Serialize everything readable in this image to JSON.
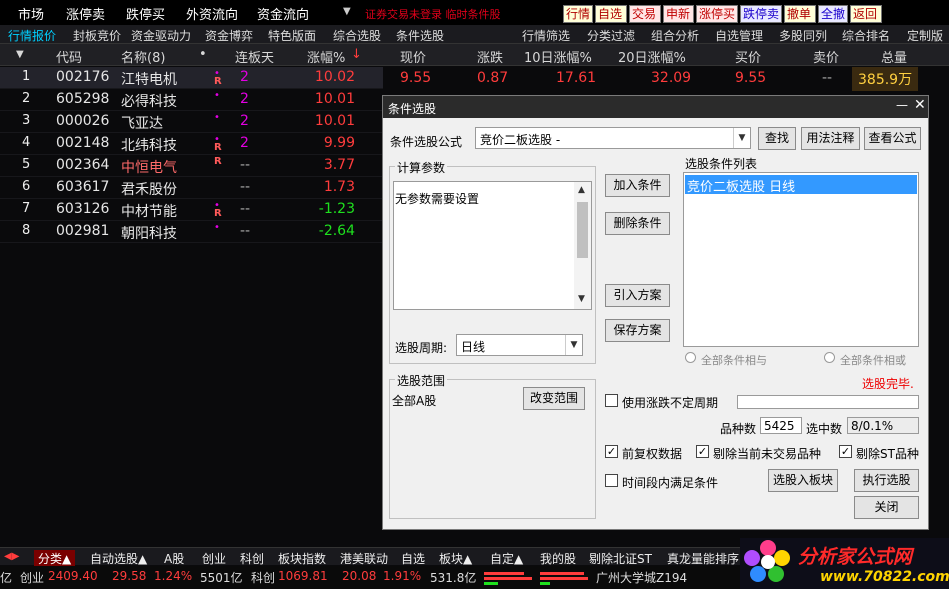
{
  "menu": [
    "市场",
    "涨停卖",
    "跌停买",
    "外资流向",
    "资金流向"
  ],
  "top_alert": "证券交易未登录  临时条件股",
  "quick": [
    {
      "label": "行情",
      "color": "#ffff00"
    },
    {
      "label": "自选",
      "color": "#ffff00"
    },
    {
      "label": "交易",
      "color": "#ff5a5a"
    },
    {
      "label": "申新",
      "color": "#ff5a5a"
    },
    {
      "label": "涨停买",
      "color": "#ff5a5a"
    },
    {
      "label": "跌停卖",
      "color": "#5a8cff"
    },
    {
      "label": "撤单",
      "color": "#ffff00"
    },
    {
      "label": "全撤",
      "color": "#5a8cff"
    },
    {
      "label": "返回",
      "color": "#ffff00"
    }
  ],
  "tabs": [
    "行情报价",
    "封板竞价",
    "资金驱动力",
    "资金博弈",
    "特色版面",
    "综合选股",
    "条件选股",
    "行情筛选",
    "分类过滤",
    "组合分析",
    "自选管理",
    "多股同列",
    "综合排名",
    "定制版"
  ],
  "header": {
    "sort": "▼",
    "code": "代码",
    "name": "名称(8)",
    "dot": "•",
    "days": "连板天",
    "pct": "涨幅%",
    "arrow": "↓",
    "price": "现价",
    "chg": "涨跌",
    "d10": "10日涨幅%",
    "d20": "20日涨幅%",
    "bid": "买价",
    "ask": "卖价",
    "total": "总量"
  },
  "rows": [
    {
      "n": "1",
      "code": "002176",
      "name": "江特电机",
      "dot": "•",
      "r": "R",
      "days": "2",
      "pct": "10.02",
      "pct_color": "red",
      "name_color": "#e6e6e6"
    },
    {
      "n": "2",
      "code": "605298",
      "name": "必得科技",
      "dot": "•",
      "r": "",
      "days": "2",
      "pct": "10.01",
      "pct_color": "red",
      "name_color": "#e6e6e6"
    },
    {
      "n": "3",
      "code": "000026",
      "name": "飞亚达",
      "dot": "•",
      "r": "",
      "days": "2",
      "pct": "10.01",
      "pct_color": "red",
      "name_color": "#e6e6e6"
    },
    {
      "n": "4",
      "code": "002148",
      "name": "北纬科技",
      "dot": "•",
      "r": "R",
      "days": "2",
      "pct": "9.99",
      "pct_color": "red",
      "name_color": "#e6e6e6"
    },
    {
      "n": "5",
      "code": "002364",
      "name": "中恒电气",
      "dot": "",
      "r": "R",
      "days": "--",
      "pct": "3.77",
      "pct_color": "red",
      "name_color": "#ff6a6a"
    },
    {
      "n": "6",
      "code": "603617",
      "name": "君禾股份",
      "dot": "",
      "r": "",
      "days": "--",
      "pct": "1.73",
      "pct_color": "red",
      "name_color": "#e6e6e6"
    },
    {
      "n": "7",
      "code": "603126",
      "name": "中材节能",
      "dot": "•",
      "r": "R",
      "days": "--",
      "pct": "-1.23",
      "pct_color": "green",
      "name_color": "#e6e6e6"
    },
    {
      "n": "8",
      "code": "002981",
      "name": "朝阳科技",
      "dot": "•",
      "r": "",
      "days": "--",
      "pct": "-2.64",
      "pct_color": "green",
      "name_color": "#e6e6e6"
    }
  ],
  "row1_extra": {
    "price": "9.55",
    "chg": "0.87",
    "d10": "17.61",
    "d20": "32.09",
    "bid": "9.55",
    "ask": "--",
    "total": "385.9万"
  },
  "dialog": {
    "title": "条件选股",
    "formula_label": "条件选股公式",
    "formula_value": "竞价二板选股  -",
    "find": "查找",
    "usage": "用法注释",
    "view": "查看公式",
    "params_title": "计算参数",
    "params_text": "无参数需要设置",
    "period_label": "选股周期:",
    "period_value": "日线",
    "add": "加入条件",
    "delete": "删除条件",
    "import": "引入方案",
    "save": "保存方案",
    "list_title": "选股条件列表",
    "list_item": "竞价二板选股  日线",
    "radio_and": "全部条件相与",
    "radio_or": "全部条件相或",
    "done": "选股完毕.",
    "range_title": "选股范围",
    "range_value": "全部A股",
    "change_range": "改变范围",
    "use_period": "使用涨跌不定周期",
    "count_label": "品种数",
    "count_value": "5425",
    "sel_label": "选中数",
    "sel_value": "8/0.1%",
    "opt1": "前复权数据",
    "opt2": "剔除当前未交易品种",
    "opt3": "剔除ST品种",
    "opt4": "时间段内满足条件",
    "to_block": "选股入板块",
    "execute": "执行选股",
    "close": "关闭"
  },
  "bottom_tabs": [
    "分类▲",
    "自动选股▲",
    "A股",
    "创业",
    "科创",
    "板块指数",
    "港美联动",
    "自选",
    "板块▲",
    "自定▲",
    "我的股",
    "剔除北证ST",
    "真龙量能排序"
  ],
  "status": {
    "s0": "亿",
    "s1": "创业",
    "s2": "2409.40",
    "s3": "29.58",
    "s4": "1.24%",
    "s5": "5501亿",
    "s6": "科创",
    "s7": "1069.81",
    "s8": "20.08",
    "s9": "1.91%",
    "s10": "531.8亿",
    "s11": "广州大学城Z194"
  },
  "logo": {
    "name": "分析家公式网",
    "url": "www.70822.com"
  }
}
